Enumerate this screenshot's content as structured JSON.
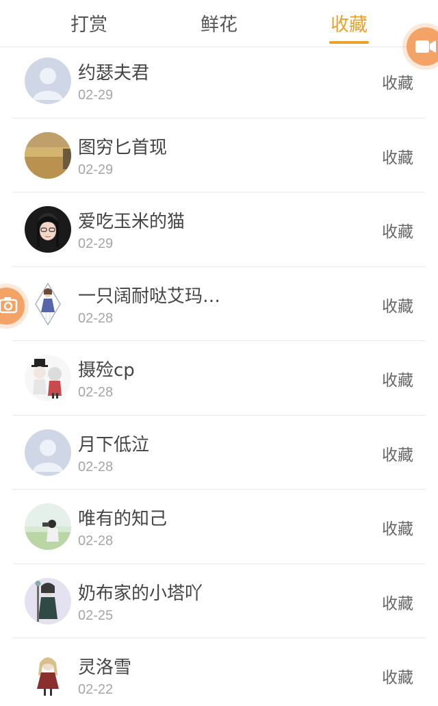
{
  "tabs": [
    {
      "label": "打赏"
    },
    {
      "label": "鲜花"
    },
    {
      "label": "收藏"
    }
  ],
  "active_tab": "收藏",
  "accent_color": "#eba02a",
  "items": [
    {
      "name": "约瑟夫君",
      "date": "02-29",
      "action": "收藏",
      "avatar": "default-avatar"
    },
    {
      "name": "图穷匕首现",
      "date": "02-29",
      "action": "收藏",
      "avatar": "field-photo"
    },
    {
      "name": "爱吃玉米的猫",
      "date": "02-29",
      "action": "收藏",
      "avatar": "girl-glasses"
    },
    {
      "name": "一只阔耐哒艾玛…",
      "date": "02-28",
      "action": "收藏",
      "avatar": "anime-figure"
    },
    {
      "name": "摄殓cp",
      "date": "02-28",
      "action": "收藏",
      "avatar": "anime-pair"
    },
    {
      "name": "月下低泣",
      "date": "02-28",
      "action": "收藏",
      "avatar": "default-avatar"
    },
    {
      "name": "唯有的知己",
      "date": "02-28",
      "action": "收藏",
      "avatar": "photographer"
    },
    {
      "name": "奶布家的小塔吖",
      "date": "02-25",
      "action": "收藏",
      "avatar": "anime-standing"
    },
    {
      "name": "灵洛雪",
      "date": "02-22",
      "action": "收藏",
      "avatar": "anime-doll"
    }
  ]
}
